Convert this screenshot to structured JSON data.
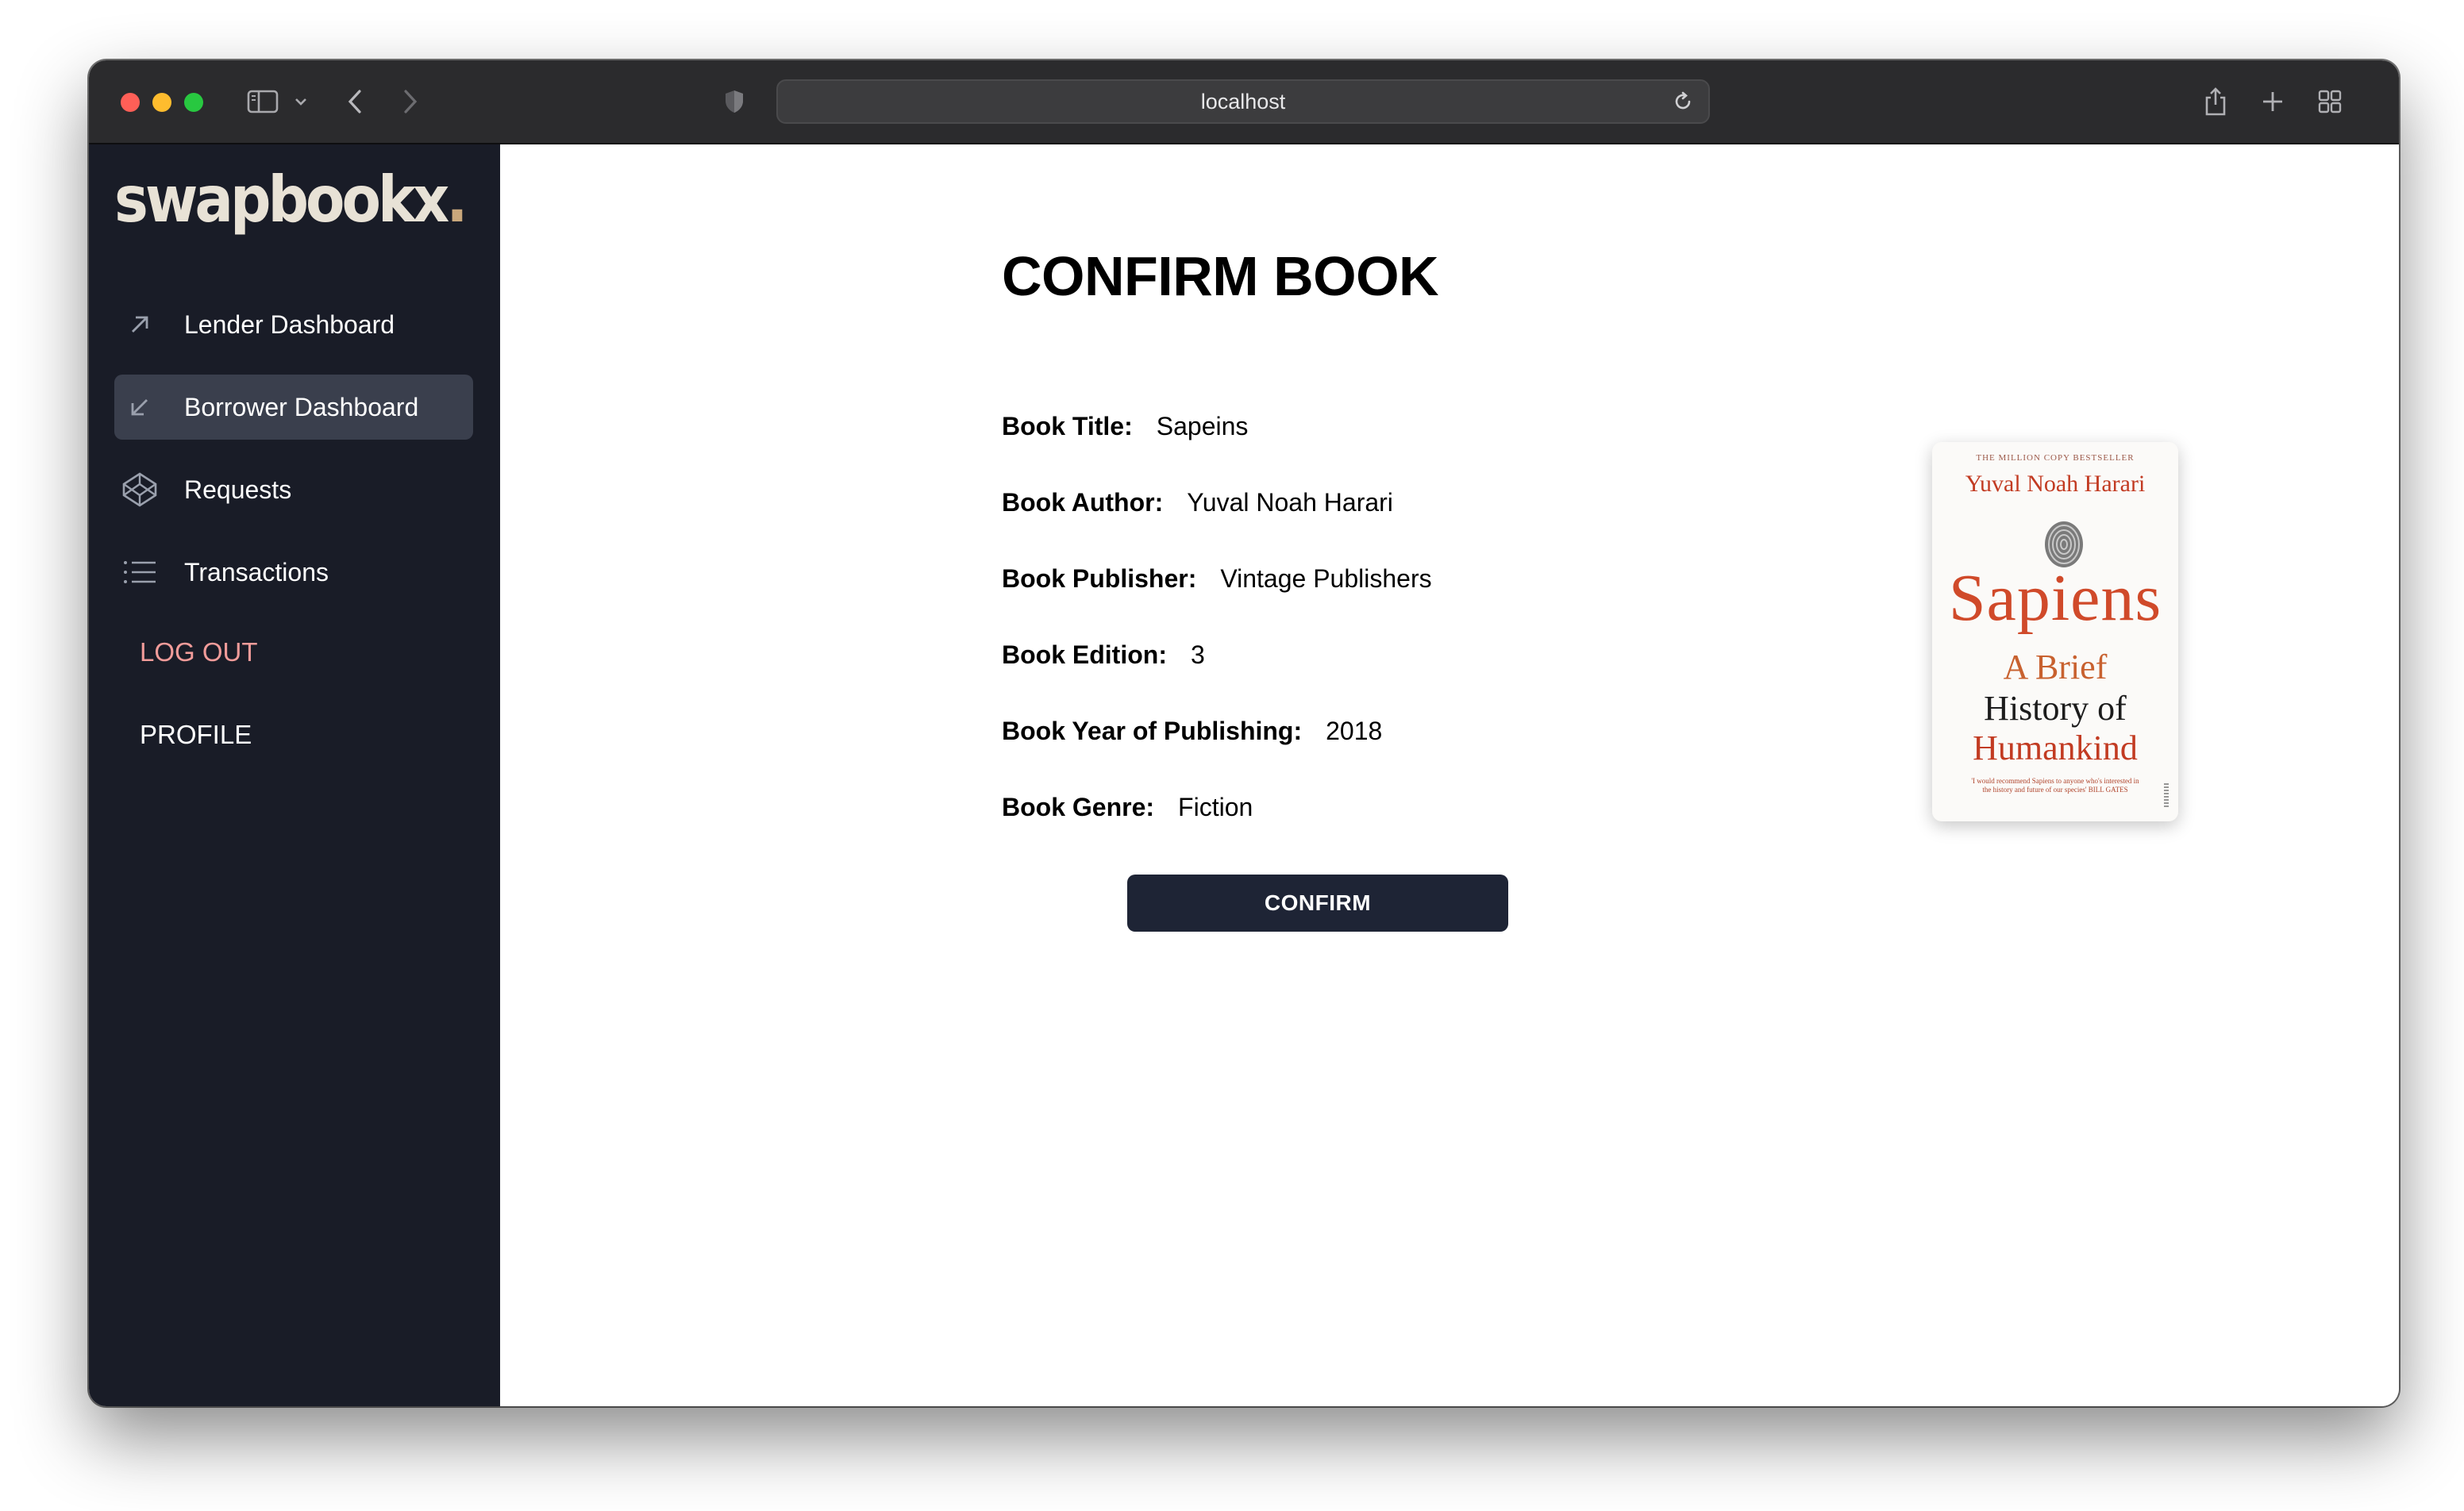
{
  "browser": {
    "url": "localhost"
  },
  "sidebar": {
    "brand": "swapbookx",
    "brand_dot": ".",
    "items": [
      {
        "label": "Lender Dashboard",
        "icon": "arrow-up-right-icon"
      },
      {
        "label": "Borrower Dashboard",
        "icon": "arrow-down-left-icon",
        "active": true
      },
      {
        "label": "Requests",
        "icon": "codepen-icon"
      },
      {
        "label": "Transactions",
        "icon": "list-icon"
      }
    ],
    "logout_label": "LOG OUT",
    "profile_label": "PROFILE"
  },
  "main": {
    "title": "CONFIRM BOOK",
    "fields": [
      {
        "label": "Book Title:",
        "value": "Sapeins"
      },
      {
        "label": "Book Author:",
        "value": "Yuval Noah Harari"
      },
      {
        "label": "Book Publisher:",
        "value": "Vintage Publishers"
      },
      {
        "label": "Book Edition:",
        "value": "3"
      },
      {
        "label": "Book Year of Publishing:",
        "value": "2018"
      },
      {
        "label": "Book Genre:",
        "value": "Fiction"
      }
    ],
    "confirm_label": "CONFIRM"
  },
  "cover": {
    "tagline": "THE MILLION COPY BESTSELLER",
    "author": "Yuval Noah Harari",
    "title": "Sapiens",
    "subtitle_line1": "A Brief",
    "subtitle_line2": "History of",
    "subtitle_line3": "Humankind",
    "quote": "'I would recommend Sapiens to anyone who's interested in the history and future of our species' BILL GATES"
  },
  "colors": {
    "sidebar_bg": "#191c27",
    "active_item_bg": "#3a3f4d",
    "logout": "#f29c9a",
    "confirm_bg": "#1e2435",
    "cover_accent": "#d04a2a"
  }
}
